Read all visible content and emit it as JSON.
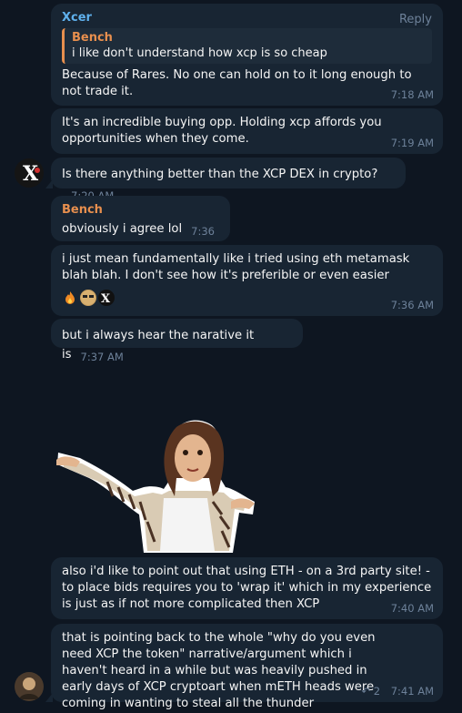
{
  "colors": {
    "background": "#0e1621",
    "bubble": "#182533",
    "accent_blue": "#5fb1ed",
    "accent_orange": "#e78f4e",
    "meta": "#6d8199"
  },
  "messages": [
    {
      "sender": "Xcer",
      "reply_label": "Reply",
      "quote_sender": "Bench",
      "quote_text": "i like don't understand how xcp is so cheap",
      "text": "Because of Rares. No one can hold on to it long enough to not trade it.",
      "time": "7:18 AM"
    },
    {
      "text": "It's an incredible buying opp. Holding xcp affords you opportunities when they come.",
      "time": "7:19 AM"
    },
    {
      "text": "Is there anything better than the XCP DEX in crypto?",
      "time": "7:20 AM"
    },
    {
      "sender": "Bench",
      "text": "obviously i agree lol",
      "time": "7:36 AM"
    },
    {
      "text": "i just mean fundamentally like i tried using eth metamask blah blah. I don't see how it's preferible or even easier",
      "time": "7:36 AM",
      "reactions": [
        "fire-emoji",
        "sunglasses-emoji",
        "x-logo"
      ]
    },
    {
      "text": "but i always hear the narative it is",
      "time": "7:37 AM"
    },
    {
      "sticker": "shrugging-woman-sticker"
    },
    {
      "text": "also i'd like to point out that using ETH - on a 3rd party site! - to place bids requires you to 'wrap it' which in my experience is just as if not more complicated then XCP",
      "time": "7:40 AM"
    },
    {
      "text": "that is pointing back to the whole \"why do you even need XCP the token\" narrative/argument which i haven't heard in a while but was heavily pushed in early days of XCP cryptoart when mETH heads were coming in wanting to steal all the thunder",
      "time": "7:41 AM",
      "replies": "2"
    }
  ]
}
